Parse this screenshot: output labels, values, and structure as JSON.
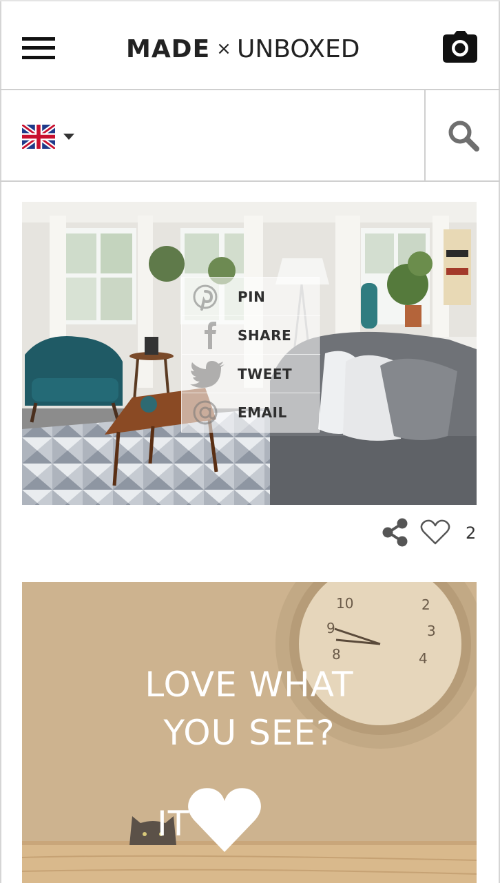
{
  "header": {
    "logo_made": "MADE",
    "logo_x": "×",
    "logo_unboxed": "UNBOXED",
    "menu_icon": "hamburger-menu-icon",
    "camera_icon": "camera-icon"
  },
  "search": {
    "language_flag": "uk-flag-icon",
    "placeholder": "",
    "value": "",
    "search_icon": "search-icon"
  },
  "post1": {
    "image": "living-room-photo",
    "share_menu": [
      {
        "icon": "pinterest-icon",
        "label": "PIN"
      },
      {
        "icon": "facebook-icon",
        "label": "SHARE"
      },
      {
        "icon": "twitter-icon",
        "label": "TWEET"
      },
      {
        "icon": "at-email-icon",
        "label": "EMAIL"
      }
    ],
    "like_count": "2"
  },
  "post2": {
    "line1": "LOVE WHAT",
    "line2": "YOU SEE?",
    "line3": "IT"
  },
  "colors": {
    "border": "#cfcfcf",
    "promo_bg": "#cdb38f",
    "text_dark": "#222222"
  }
}
